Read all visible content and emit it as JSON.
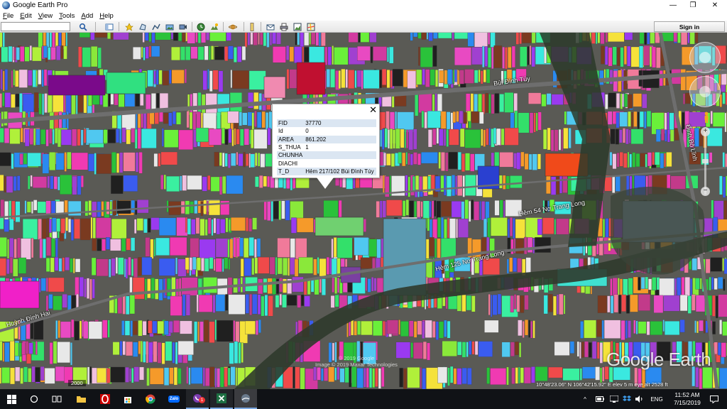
{
  "window": {
    "title": "Google Earth Pro",
    "minimize": "—",
    "maximize": "❐",
    "close": "✕"
  },
  "menu": [
    "File",
    "Edit",
    "View",
    "Tools",
    "Add",
    "Help"
  ],
  "toolbar": {
    "search_value": "",
    "signin_label": "Sign in",
    "icons": [
      "search-icon",
      "sidebar-toggle-icon",
      "placemark-icon",
      "polygon-icon",
      "path-icon",
      "image-overlay-icon",
      "record-tour-icon",
      "historical-imagery-icon",
      "sunlight-icon",
      "planets-icon",
      "ruler-icon",
      "email-icon",
      "print-icon",
      "save-image-icon",
      "view-in-maps-icon"
    ]
  },
  "balloon": {
    "close_symbol": "✕",
    "rows": [
      {
        "key": "FID",
        "value": "37770"
      },
      {
        "key": "Id",
        "value": "0"
      },
      {
        "key": "AREA",
        "value": "861.202"
      },
      {
        "key": "S_THUA",
        "value": "1"
      },
      {
        "key": "CHUNHA",
        "value": ""
      },
      {
        "key": "DIACHI",
        "value": ""
      },
      {
        "key": "T_D",
        "value": "Hẻm 217/102 Bùi Đình Túy"
      }
    ]
  },
  "map": {
    "road_labels": [
      "Bùi Đình Túy",
      "Huỳnh Đình Hai",
      "Hẻm 125 Nơ Trang Long",
      "Đinh Bộ Lĩnh",
      "Hẻm 54 Nơ Trang Long"
    ],
    "watermark": "Google Earth",
    "copyright_line1": "© 2019 Google",
    "copyright_line2": "Image © 2019 Maxar Technologies",
    "historical_year": "2000",
    "status": "10°48'23.06\" N   106°42'15.92\" E   elev   5 m   eye alt   2528 ft"
  },
  "taskbar": {
    "apps": [
      "windows-start-icon",
      "cortana-search-icon",
      "task-view-icon",
      "file-explorer-icon",
      "opera-icon",
      "store-icon",
      "chrome-icon",
      "zalo-icon",
      "viber-icon",
      "excel-icon",
      "google-earth-icon"
    ],
    "zalo_label": "Zalo",
    "viber_badge": "1",
    "language": "ENG",
    "time": "11:52 AM",
    "date": "7/15/2019"
  }
}
